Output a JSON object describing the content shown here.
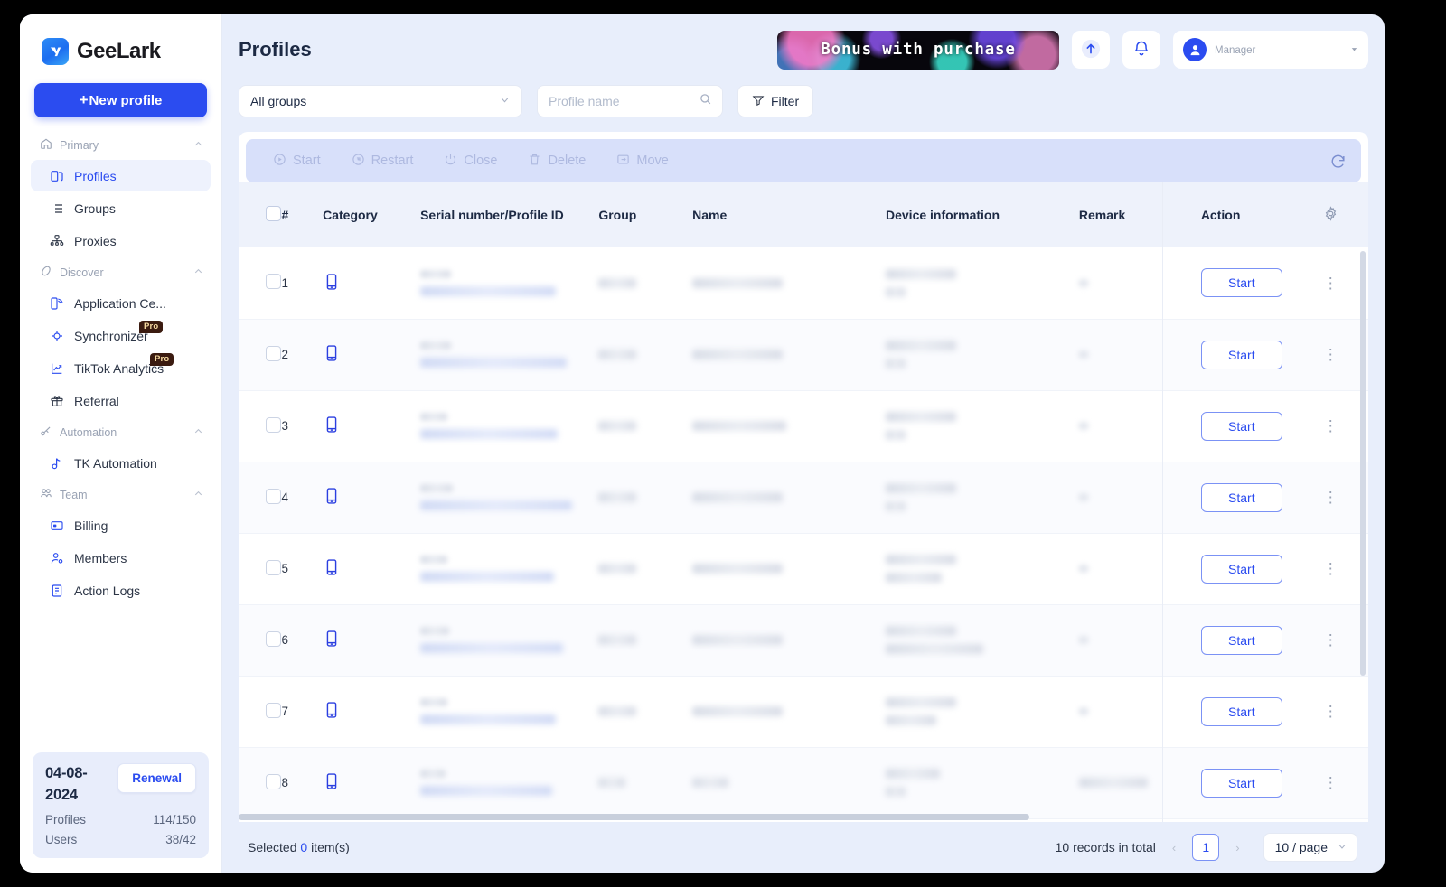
{
  "brand": {
    "name": "GeeLark",
    "logo_icon": "geelark-logo-icon"
  },
  "sidebar": {
    "new_profile_label": "New profile",
    "new_profile_plus": "+",
    "groups": [
      {
        "label": "Primary",
        "icon": "home-icon",
        "chevron": "chevron-up-icon",
        "items": [
          {
            "label": "Profiles",
            "icon": "profiles-icon",
            "active": true
          },
          {
            "label": "Groups",
            "icon": "groups-list-icon",
            "active": false
          },
          {
            "label": "Proxies",
            "icon": "proxies-network-icon",
            "active": false
          }
        ]
      },
      {
        "label": "Discover",
        "icon": "compass-icon",
        "chevron": "chevron-up-icon",
        "items": [
          {
            "label": "Application Ce...",
            "icon": "application-center-icon",
            "active": false
          },
          {
            "label": "Synchronizer",
            "icon": "synchronizer-icon",
            "active": false,
            "badge": "Pro"
          },
          {
            "label": "TikTok Analytics",
            "icon": "analytics-chart-icon",
            "active": false,
            "badge": "Pro"
          },
          {
            "label": "Referral",
            "icon": "gift-icon",
            "active": false
          }
        ]
      },
      {
        "label": "Automation",
        "icon": "automation-icon",
        "chevron": "chevron-up-icon",
        "items": [
          {
            "label": "TK Automation",
            "icon": "tiktok-note-icon",
            "active": false
          }
        ]
      },
      {
        "label": "Team",
        "icon": "team-people-icon",
        "chevron": "chevron-up-icon",
        "items": [
          {
            "label": "Billing",
            "icon": "billing-card-icon",
            "active": false
          },
          {
            "label": "Members",
            "icon": "members-icon",
            "active": false
          },
          {
            "label": "Action Logs",
            "icon": "action-logs-icon",
            "active": false
          }
        ]
      }
    ],
    "renewal": {
      "date": "04-08-2024",
      "button_label": "Renewal",
      "stats": [
        {
          "label": "Profiles",
          "value": "114/150"
        },
        {
          "label": "Users",
          "value": "38/42"
        }
      ]
    }
  },
  "header": {
    "title": "Profiles",
    "promo_banner": {
      "text": "Bonus with purchase",
      "name": "promo-banner"
    },
    "upgrade_icon": "arrow-up-icon",
    "notification_icon": "bell-icon",
    "user": {
      "avatar_icon": "user-avatar-icon",
      "name": "",
      "role": "Manager",
      "caret": "chevron-down-icon"
    }
  },
  "filters": {
    "group_select": {
      "value": "All groups",
      "caret": "chevron-down-icon"
    },
    "search": {
      "value": "",
      "placeholder": "Profile name",
      "icon": "search-icon"
    },
    "filter_button": {
      "label": "Filter",
      "icon": "filter-icon"
    }
  },
  "bulk_actions": {
    "items": [
      {
        "label": "Start",
        "icon": "play-circle-icon"
      },
      {
        "label": "Restart",
        "icon": "restart-circle-icon"
      },
      {
        "label": "Close",
        "icon": "power-icon"
      },
      {
        "label": "Delete",
        "icon": "trash-icon"
      },
      {
        "label": "Move",
        "icon": "move-folder-icon"
      }
    ],
    "refresh_icon": "refresh-icon"
  },
  "table": {
    "settings_icon": "gear-icon",
    "columns": [
      "#",
      "Category",
      "Serial number/Profile ID",
      "Group",
      "Name",
      "Device information",
      "Remark",
      "Action"
    ],
    "rows": [
      {
        "num": "1",
        "category_icon": "phone-icon",
        "action_label": "Start",
        "menu_icon": "kebab-menu-icon"
      },
      {
        "num": "2",
        "category_icon": "phone-icon",
        "action_label": "Start",
        "menu_icon": "kebab-menu-icon"
      },
      {
        "num": "3",
        "category_icon": "phone-icon",
        "action_label": "Start",
        "menu_icon": "kebab-menu-icon"
      },
      {
        "num": "4",
        "category_icon": "phone-icon",
        "action_label": "Start",
        "menu_icon": "kebab-menu-icon"
      },
      {
        "num": "5",
        "category_icon": "phone-icon",
        "action_label": "Start",
        "menu_icon": "kebab-menu-icon"
      },
      {
        "num": "6",
        "category_icon": "phone-icon",
        "action_label": "Start",
        "menu_icon": "kebab-menu-icon"
      },
      {
        "num": "7",
        "category_icon": "phone-icon",
        "action_label": "Start",
        "menu_icon": "kebab-menu-icon"
      },
      {
        "num": "8",
        "category_icon": "phone-icon",
        "action_label": "Start",
        "menu_icon": "kebab-menu-icon"
      }
    ]
  },
  "footer": {
    "selected_prefix": "Selected",
    "selected_count": "0",
    "selected_suffix": "item(s)",
    "records_total": "10 records in total",
    "prev_arrow": "‹",
    "current_page": "1",
    "next_arrow": "›",
    "page_size": "10 / page",
    "page_size_caret": "chevron-down-icon"
  },
  "colors": {
    "accent": "#2b4cf0",
    "app_bg": "#e8eefb",
    "header_row": "#eef2fb",
    "bulkbar": "#d8e0fa",
    "pro_badge": "#3b1b10"
  }
}
